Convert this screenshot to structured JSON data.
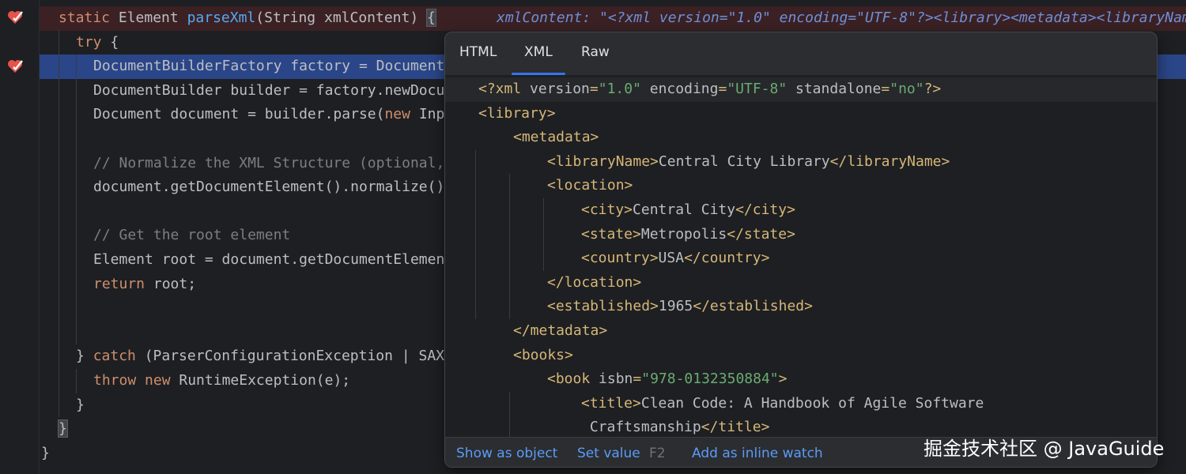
{
  "editor": {
    "lines": [
      {
        "parts": [
          [
            "kw",
            "static"
          ],
          [
            "",
            "Element "
          ],
          [
            "fn",
            "parseXml"
          ],
          [
            "",
            "(String xmlContent) "
          ],
          [
            "brace",
            "{"
          ]
        ]
      },
      {
        "parts": [
          [
            "kw",
            "try"
          ],
          [
            "",
            " {"
          ]
        ]
      },
      {
        "parts": [
          [
            "",
            "DocumentBuilderFactory factory = Document"
          ]
        ]
      },
      {
        "parts": [
          [
            "",
            "DocumentBuilder builder = factory.newDocu"
          ]
        ]
      },
      {
        "parts": [
          [
            "",
            "Document document = builder.parse("
          ],
          [
            "kw",
            "new"
          ],
          [
            "",
            " Inp"
          ]
        ]
      },
      {
        "parts": []
      },
      {
        "parts": [
          [
            "cm",
            "// Normalize the XML Structure (optional,"
          ]
        ]
      },
      {
        "parts": [
          [
            "",
            "document.getDocumentElement().normalize()"
          ]
        ]
      },
      {
        "parts": []
      },
      {
        "parts": [
          [
            "cm",
            "// Get the root element"
          ]
        ]
      },
      {
        "parts": [
          [
            "",
            "Element root = document.getDocumentElemen"
          ]
        ]
      },
      {
        "parts": [
          [
            "kw",
            "return"
          ],
          [
            "",
            " root;"
          ]
        ]
      },
      {
        "parts": []
      },
      {
        "parts": []
      },
      {
        "parts": [
          [
            "",
            "} "
          ],
          [
            "kw",
            "catch"
          ],
          [
            "",
            " (ParserConfigurationException | SAX"
          ]
        ]
      },
      {
        "parts": [
          [
            "kw",
            "throw"
          ],
          [
            "",
            " "
          ],
          [
            "kw",
            "new"
          ],
          [
            "",
            " RuntimeException(e);"
          ]
        ]
      },
      {
        "parts": [
          [
            "",
            "}"
          ]
        ]
      },
      {
        "parts": [
          [
            "brace",
            "}"
          ]
        ]
      },
      {
        "parts": [
          [
            "",
            "}"
          ]
        ]
      }
    ],
    "inline_hint": "xmlContent: \"<?xml version=\"1.0\" encoding=\"UTF-8\"?><library><metadata><libraryName>Ce"
  },
  "popup": {
    "tabs": [
      "HTML",
      "XML",
      "Raw"
    ],
    "active_tab": "XML",
    "xml_lines": [
      {
        "parts": [
          [
            "tag",
            "<?xml "
          ],
          [
            "attr",
            "version"
          ],
          [
            "tag",
            "="
          ],
          [
            "val",
            "\"1.0\""
          ],
          [
            "attr",
            " encoding"
          ],
          [
            "tag",
            "="
          ],
          [
            "val",
            "\"UTF-8\""
          ],
          [
            "attr",
            " standalone"
          ],
          [
            "tag",
            "="
          ],
          [
            "val",
            "\"no\""
          ],
          [
            "tag",
            "?>"
          ]
        ]
      },
      {
        "parts": [
          [
            "tag",
            "<library>"
          ]
        ]
      },
      {
        "parts": [
          [
            "tag",
            "<metadata>"
          ]
        ]
      },
      {
        "parts": [
          [
            "tag",
            "<libraryName>"
          ],
          [
            "txt",
            "Central City Library"
          ],
          [
            "tag",
            "</libraryName>"
          ]
        ]
      },
      {
        "parts": [
          [
            "tag",
            "<location>"
          ]
        ]
      },
      {
        "parts": [
          [
            "tag",
            "<city>"
          ],
          [
            "txt",
            "Central City"
          ],
          [
            "tag",
            "</city>"
          ]
        ]
      },
      {
        "parts": [
          [
            "tag",
            "<state>"
          ],
          [
            "txt",
            "Metropolis"
          ],
          [
            "tag",
            "</state>"
          ]
        ]
      },
      {
        "parts": [
          [
            "tag",
            "<country>"
          ],
          [
            "txt",
            "USA"
          ],
          [
            "tag",
            "</country>"
          ]
        ]
      },
      {
        "parts": [
          [
            "tag",
            "</location>"
          ]
        ]
      },
      {
        "parts": [
          [
            "tag",
            "<established>"
          ],
          [
            "txt",
            "1965"
          ],
          [
            "tag",
            "</established>"
          ]
        ]
      },
      {
        "parts": [
          [
            "tag",
            "</metadata>"
          ]
        ]
      },
      {
        "parts": [
          [
            "tag",
            "<books>"
          ]
        ]
      },
      {
        "parts": [
          [
            "tag",
            "<book "
          ],
          [
            "attr",
            "isbn"
          ],
          [
            "tag",
            "="
          ],
          [
            "val",
            "\"978-0132350884\""
          ],
          [
            "tag",
            ">"
          ]
        ]
      },
      {
        "parts": [
          [
            "tag",
            "<title>"
          ],
          [
            "txt",
            "Clean Code: A Handbook of Agile Software"
          ]
        ]
      },
      {
        "parts": [
          [
            "txt",
            " Craftsmanship"
          ],
          [
            "tag",
            "</title>"
          ]
        ]
      }
    ],
    "footer": {
      "show_as_object": "Show as object",
      "set_value": "Set value",
      "set_value_key": "F2",
      "add_inline_watch": "Add as inline watch"
    }
  },
  "watermark": "掘金技术社区 @ JavaGuide",
  "colors": {
    "breakpoint_line": "#3b2124",
    "current_line": "#2a4688",
    "keyword": "#cf8e6d",
    "function": "#56a8f5",
    "xml_tag": "#d5b778",
    "xml_value": "#6aab73",
    "link": "#5b9bf8"
  }
}
